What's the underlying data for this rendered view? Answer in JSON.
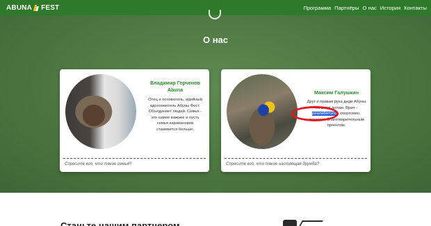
{
  "brand": {
    "logo_left": "ABUNA",
    "logo_right": "FEST"
  },
  "nav": {
    "items": [
      "Программа",
      "Партнёры",
      "О нас",
      "История",
      "Контакты"
    ]
  },
  "about": {
    "title": "О нас"
  },
  "people": [
    {
      "name": "Владимир Герченов Abuna",
      "description": "Отец и основатель, идейный вдохновитель Абуны Фест. Объединяет людей. Семья - это самое важное и пусть семья караванеров становится больше.",
      "link": "Спросите его, что такое семья?"
    },
    {
      "name": "Максим Галушкин",
      "desc_before": "Друг и правая рука деди Абуны по всем делам. Врач - ",
      "desc_highlight": "реалибитолог",
      "desc_after": ", спортсмен, помогает благотворительным проектам.",
      "link": "Спросите его, что такое настоящая дружба?"
    }
  ],
  "partner": {
    "title": "Станьте нашим партнером"
  },
  "colors": {
    "nav": "#2f7a2a",
    "accent": "#2e8b2e",
    "highlight": "#2a61d6",
    "annotation": "#e5171d"
  }
}
